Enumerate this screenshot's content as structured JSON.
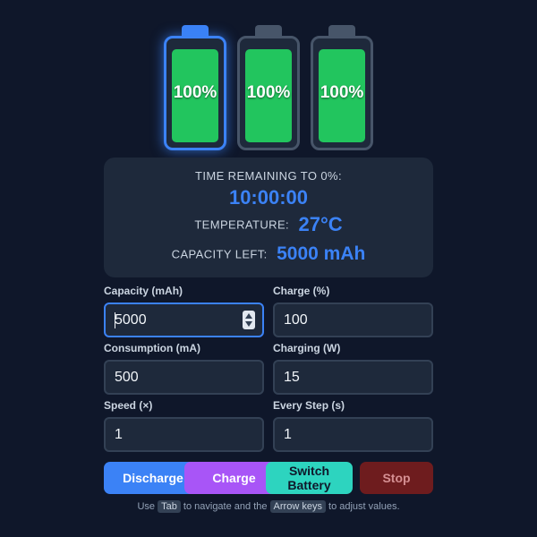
{
  "batteries": [
    {
      "label": "100%",
      "level": 1.0,
      "active": true
    },
    {
      "label": "100%",
      "level": 1.0,
      "active": false
    },
    {
      "label": "100%",
      "level": 1.0,
      "active": false
    }
  ],
  "status": {
    "time_label": "TIME REMAINING TO 0%:",
    "time_value": "10:00:00",
    "temp_label": "TEMPERATURE:",
    "temp_value": "27°C",
    "capacity_label": "CAPACITY LEFT:",
    "capacity_value": "5000 mAh"
  },
  "fields": {
    "capacity": {
      "label": "Capacity (mAh)",
      "value": "5000"
    },
    "charge": {
      "label": "Charge (%)",
      "value": "100"
    },
    "consumption": {
      "label": "Consumption (mA)",
      "value": "500"
    },
    "charging": {
      "label": "Charging (W)",
      "value": "15"
    },
    "speed": {
      "label": "Speed (×)",
      "value": "1"
    },
    "every_step": {
      "label": "Every Step (s)",
      "value": "1"
    }
  },
  "buttons": {
    "discharge": "Discharge",
    "charge": "Charge",
    "switch": "Switch Battery",
    "stop": "Stop"
  },
  "hint": {
    "before": "Use",
    "key1": "Tab",
    "middle": "to navigate and the",
    "key2": "Arrow keys",
    "after": "to adjust values."
  },
  "colors": {
    "background": "#0f172a",
    "panel": "#1e293b",
    "accent": "#3b82f6",
    "battery_fill": "#22c55e",
    "charge": "#a855f7",
    "switch": "#2dd4bf",
    "stop": "#7f1d1d"
  }
}
